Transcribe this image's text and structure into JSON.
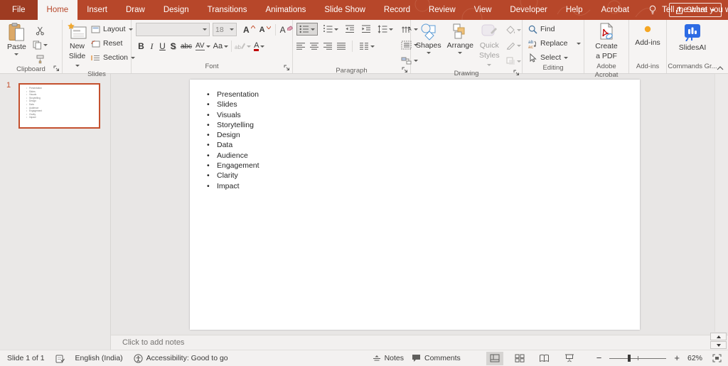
{
  "titlebar": {
    "tabs": [
      "File",
      "Home",
      "Insert",
      "Draw",
      "Design",
      "Transitions",
      "Animations",
      "Slide Show",
      "Record",
      "Review",
      "View",
      "Developer",
      "Help",
      "Acrobat"
    ],
    "active_tab": "Home",
    "tell_me": "Tell me what you want to do",
    "share": "Share"
  },
  "ribbon": {
    "clipboard": {
      "label": "Clipboard",
      "paste": "Paste"
    },
    "slides": {
      "label": "Slides",
      "new_slide_line1": "New",
      "new_slide_line2": "Slide",
      "layout": "Layout",
      "reset": "Reset",
      "section": "Section"
    },
    "font": {
      "label": "Font",
      "font_name": "",
      "font_size": "18",
      "bold": "B",
      "italic": "I",
      "underline": "U",
      "shadow": "S",
      "strikethrough": "abc",
      "char_spacing": "AV",
      "change_case": "Aa",
      "font_color": "A"
    },
    "paragraph": {
      "label": "Paragraph"
    },
    "drawing": {
      "label": "Drawing",
      "shapes": "Shapes",
      "arrange": "Arrange",
      "quick_styles_line1": "Quick",
      "quick_styles_line2": "Styles"
    },
    "editing": {
      "label": "Editing",
      "find": "Find",
      "replace": "Replace",
      "select": "Select"
    },
    "acrobat": {
      "label": "Adobe Acrobat",
      "create_pdf_line1": "Create",
      "create_pdf_line2": "a PDF"
    },
    "addins": {
      "label": "Add-ins",
      "button": "Add-ins"
    },
    "slidesai": {
      "label": "Commands Gr...",
      "button": "SlidesAI"
    }
  },
  "thumbnail_panel": {
    "slide_number": "1"
  },
  "slide": {
    "bullets": [
      "Presentation",
      "Slides",
      "Visuals",
      "Storytelling",
      "Design",
      "Data",
      "Audience",
      "Engagement",
      "Clarity",
      "Impact"
    ]
  },
  "notes": {
    "placeholder": "Click to add notes"
  },
  "statusbar": {
    "slide_info": "Slide 1 of 1",
    "language": "English (India)",
    "accessibility": "Accessibility: Good to go",
    "notes": "Notes",
    "comments": "Comments",
    "zoom_percent": "62%"
  },
  "colors": {
    "brand_red": "#B7472A",
    "file_tab_red": "#9E3B21",
    "selection_red": "#C4502E",
    "addin_orange": "#F5A623",
    "slidesai_blue": "#2D6BE4"
  }
}
